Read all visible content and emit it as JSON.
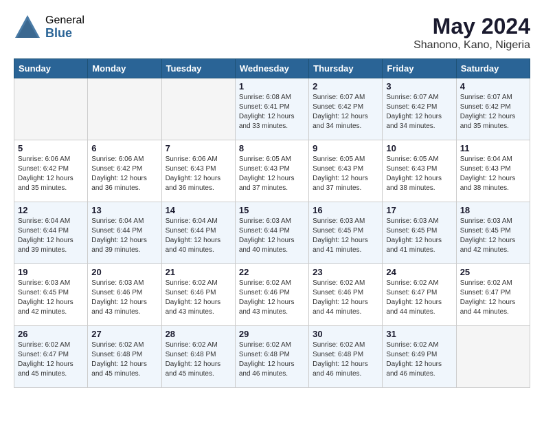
{
  "header": {
    "logo_general": "General",
    "logo_blue": "Blue",
    "month_year": "May 2024",
    "location": "Shanono, Kano, Nigeria"
  },
  "days_of_week": [
    "Sunday",
    "Monday",
    "Tuesday",
    "Wednesday",
    "Thursday",
    "Friday",
    "Saturday"
  ],
  "weeks": [
    [
      {
        "day": "",
        "info": ""
      },
      {
        "day": "",
        "info": ""
      },
      {
        "day": "",
        "info": ""
      },
      {
        "day": "1",
        "info": "Sunrise: 6:08 AM\nSunset: 6:41 PM\nDaylight: 12 hours\nand 33 minutes."
      },
      {
        "day": "2",
        "info": "Sunrise: 6:07 AM\nSunset: 6:42 PM\nDaylight: 12 hours\nand 34 minutes."
      },
      {
        "day": "3",
        "info": "Sunrise: 6:07 AM\nSunset: 6:42 PM\nDaylight: 12 hours\nand 34 minutes."
      },
      {
        "day": "4",
        "info": "Sunrise: 6:07 AM\nSunset: 6:42 PM\nDaylight: 12 hours\nand 35 minutes."
      }
    ],
    [
      {
        "day": "5",
        "info": "Sunrise: 6:06 AM\nSunset: 6:42 PM\nDaylight: 12 hours\nand 35 minutes."
      },
      {
        "day": "6",
        "info": "Sunrise: 6:06 AM\nSunset: 6:42 PM\nDaylight: 12 hours\nand 36 minutes."
      },
      {
        "day": "7",
        "info": "Sunrise: 6:06 AM\nSunset: 6:43 PM\nDaylight: 12 hours\nand 36 minutes."
      },
      {
        "day": "8",
        "info": "Sunrise: 6:05 AM\nSunset: 6:43 PM\nDaylight: 12 hours\nand 37 minutes."
      },
      {
        "day": "9",
        "info": "Sunrise: 6:05 AM\nSunset: 6:43 PM\nDaylight: 12 hours\nand 37 minutes."
      },
      {
        "day": "10",
        "info": "Sunrise: 6:05 AM\nSunset: 6:43 PM\nDaylight: 12 hours\nand 38 minutes."
      },
      {
        "day": "11",
        "info": "Sunrise: 6:04 AM\nSunset: 6:43 PM\nDaylight: 12 hours\nand 38 minutes."
      }
    ],
    [
      {
        "day": "12",
        "info": "Sunrise: 6:04 AM\nSunset: 6:44 PM\nDaylight: 12 hours\nand 39 minutes."
      },
      {
        "day": "13",
        "info": "Sunrise: 6:04 AM\nSunset: 6:44 PM\nDaylight: 12 hours\nand 39 minutes."
      },
      {
        "day": "14",
        "info": "Sunrise: 6:04 AM\nSunset: 6:44 PM\nDaylight: 12 hours\nand 40 minutes."
      },
      {
        "day": "15",
        "info": "Sunrise: 6:03 AM\nSunset: 6:44 PM\nDaylight: 12 hours\nand 40 minutes."
      },
      {
        "day": "16",
        "info": "Sunrise: 6:03 AM\nSunset: 6:45 PM\nDaylight: 12 hours\nand 41 minutes."
      },
      {
        "day": "17",
        "info": "Sunrise: 6:03 AM\nSunset: 6:45 PM\nDaylight: 12 hours\nand 41 minutes."
      },
      {
        "day": "18",
        "info": "Sunrise: 6:03 AM\nSunset: 6:45 PM\nDaylight: 12 hours\nand 42 minutes."
      }
    ],
    [
      {
        "day": "19",
        "info": "Sunrise: 6:03 AM\nSunset: 6:45 PM\nDaylight: 12 hours\nand 42 minutes."
      },
      {
        "day": "20",
        "info": "Sunrise: 6:03 AM\nSunset: 6:46 PM\nDaylight: 12 hours\nand 43 minutes."
      },
      {
        "day": "21",
        "info": "Sunrise: 6:02 AM\nSunset: 6:46 PM\nDaylight: 12 hours\nand 43 minutes."
      },
      {
        "day": "22",
        "info": "Sunrise: 6:02 AM\nSunset: 6:46 PM\nDaylight: 12 hours\nand 43 minutes."
      },
      {
        "day": "23",
        "info": "Sunrise: 6:02 AM\nSunset: 6:46 PM\nDaylight: 12 hours\nand 44 minutes."
      },
      {
        "day": "24",
        "info": "Sunrise: 6:02 AM\nSunset: 6:47 PM\nDaylight: 12 hours\nand 44 minutes."
      },
      {
        "day": "25",
        "info": "Sunrise: 6:02 AM\nSunset: 6:47 PM\nDaylight: 12 hours\nand 44 minutes."
      }
    ],
    [
      {
        "day": "26",
        "info": "Sunrise: 6:02 AM\nSunset: 6:47 PM\nDaylight: 12 hours\nand 45 minutes."
      },
      {
        "day": "27",
        "info": "Sunrise: 6:02 AM\nSunset: 6:48 PM\nDaylight: 12 hours\nand 45 minutes."
      },
      {
        "day": "28",
        "info": "Sunrise: 6:02 AM\nSunset: 6:48 PM\nDaylight: 12 hours\nand 45 minutes."
      },
      {
        "day": "29",
        "info": "Sunrise: 6:02 AM\nSunset: 6:48 PM\nDaylight: 12 hours\nand 46 minutes."
      },
      {
        "day": "30",
        "info": "Sunrise: 6:02 AM\nSunset: 6:48 PM\nDaylight: 12 hours\nand 46 minutes."
      },
      {
        "day": "31",
        "info": "Sunrise: 6:02 AM\nSunset: 6:49 PM\nDaylight: 12 hours\nand 46 minutes."
      },
      {
        "day": "",
        "info": ""
      }
    ]
  ]
}
